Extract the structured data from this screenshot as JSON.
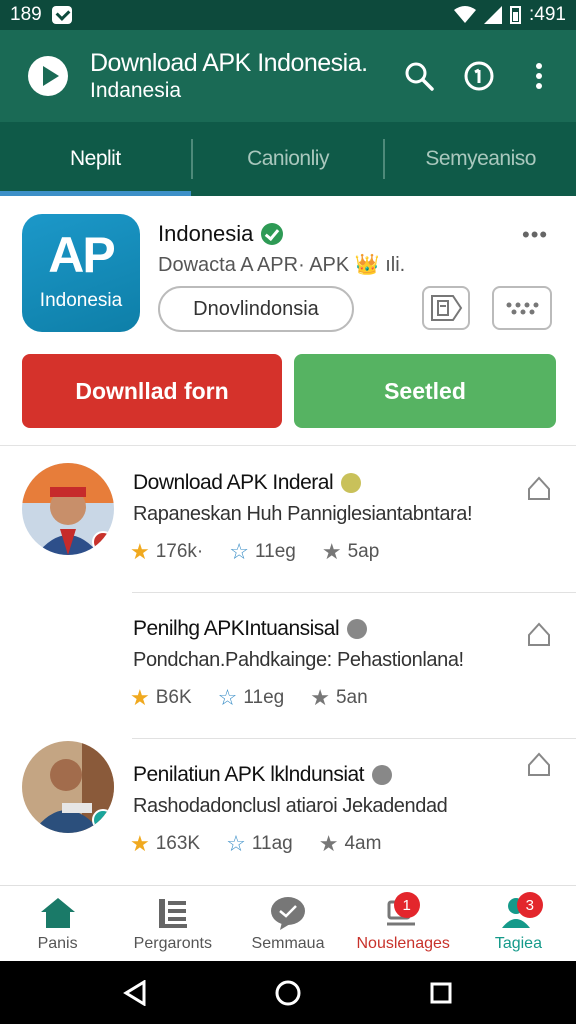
{
  "status_bar": {
    "time": "189",
    "right_text": ":491"
  },
  "app_bar": {
    "title": "Download APK Indonesia.",
    "subtitle": "Indanesia",
    "icons": [
      "play-logo-icon",
      "search-icon",
      "info-circle-icon",
      "more-vert-icon"
    ]
  },
  "tabs": [
    {
      "label": "Neplit",
      "active": true
    },
    {
      "label": "Canionliy",
      "active": false
    },
    {
      "label": "Semyeaniso",
      "active": false
    }
  ],
  "featured": {
    "icon_big": "AP",
    "icon_small": "Indonesia",
    "name": "Indonesia",
    "subtitle": "Dowacta A APR· APK 👑 ıli.",
    "more": "•••",
    "pill_label": "Dnovlindonsia",
    "primary_button": "Downllad forn",
    "secondary_button": "Seetled"
  },
  "items": [
    {
      "title": "Download APK Inderal",
      "desc": "Rapaneskan Huh Panniglesiantabntara!",
      "badge": "gold",
      "stats": [
        {
          "value": "176k·",
          "star": "filled"
        },
        {
          "value": "11eg",
          "star": "outline-blue"
        },
        {
          "value": "5ap",
          "star": "grey"
        }
      ]
    },
    {
      "title": "Penilhg APKIntuansisal",
      "desc": "Pondchan.Pahdkainge: Pehastionlana!",
      "badge": "grey",
      "stats": [
        {
          "value": "B6K",
          "star": "filled"
        },
        {
          "value": "11eg",
          "star": "outline-blue"
        },
        {
          "value": "5an",
          "star": "grey"
        }
      ]
    },
    {
      "title": "Penilatiun APK lklndunsiat",
      "desc": "Rashodadonclusl atiaroi Jekadendad",
      "badge": "grey",
      "stats": [
        {
          "value": "163K",
          "star": "filled"
        },
        {
          "value": "11ag",
          "star": "outline-blue"
        },
        {
          "value": "4am",
          "star": "grey"
        }
      ]
    }
  ],
  "bottom_nav": [
    {
      "label": "Panis",
      "icon": "home-icon",
      "color": "#1a7a68"
    },
    {
      "label": "Pergaronts",
      "icon": "list-icon",
      "color": "#555555"
    },
    {
      "label": "Semmaua",
      "icon": "chat-icon",
      "color": "#555555"
    },
    {
      "label": "Nouslenages",
      "icon": "notification-icon",
      "color": "#c8322b",
      "badge": "1"
    },
    {
      "label": "Tagiea",
      "icon": "people-icon",
      "color": "#159a8a",
      "badge": "3"
    }
  ],
  "colors": {
    "status_bar": "#0d4a3c",
    "app_bar": "#1a6a55",
    "tabs": "#0f5a48",
    "tab_indicator": "#3d90c8",
    "primary_red": "#d5322b",
    "primary_green": "#56b362"
  }
}
